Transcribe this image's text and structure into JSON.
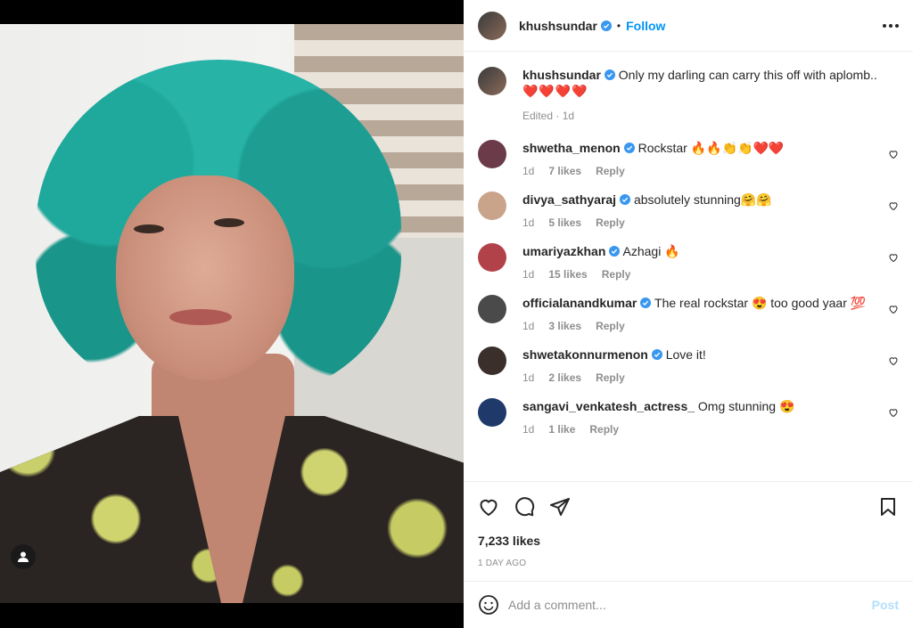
{
  "post": {
    "author": "khushsundar",
    "follow_label": "Follow",
    "separator": "•"
  },
  "caption": {
    "author": "khushsundar",
    "text": "Only my darling can carry this off with aplomb..",
    "hearts": "❤️❤️❤️❤️",
    "meta": "Edited · 1d"
  },
  "comments": [
    {
      "user": "shwetha_menon",
      "text": "Rockstar 🔥🔥👏👏❤️❤️",
      "time": "1d",
      "likes": "7 likes",
      "reply": "Reply",
      "avatar_color": "#6b3b4a"
    },
    {
      "user": "divya_sathyaraj",
      "text": "absolutely stunning🤗🤗",
      "time": "1d",
      "likes": "5 likes",
      "reply": "Reply",
      "avatar_color": "#c9a48a"
    },
    {
      "user": "umariyazkhan",
      "text": "Azhagi 🔥",
      "time": "1d",
      "likes": "15 likes",
      "reply": "Reply",
      "avatar_color": "#b2424a"
    },
    {
      "user": "officialanandkumar",
      "text": "The real rockstar 😍 too good yaar 💯",
      "time": "1d",
      "likes": "3 likes",
      "reply": "Reply",
      "avatar_color": "#4a4a4a"
    },
    {
      "user": "shwetakonnurmenon",
      "text": "Love it!",
      "time": "1d",
      "likes": "2 likes",
      "reply": "Reply",
      "avatar_color": "#3a2f2a"
    },
    {
      "user": "sangavi_venkatesh_actress_",
      "text": "Omg stunning 😍",
      "time": "1d",
      "likes": "1 like",
      "reply": "Reply",
      "avatar_color": "#1f3a6a"
    }
  ],
  "stats": {
    "likes": "7,233 likes",
    "ago": "1 DAY AGO"
  },
  "add_comment": {
    "placeholder": "Add a comment...",
    "post_label": "Post"
  },
  "colors": {
    "accent": "#0095f6",
    "verified": "#3897f0",
    "post_disabled": "#b2dffc"
  }
}
